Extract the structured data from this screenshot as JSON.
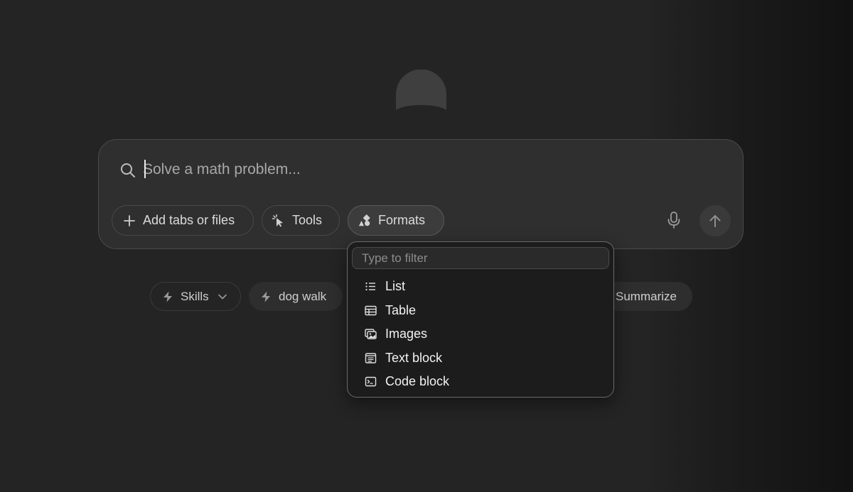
{
  "composer": {
    "placeholder": "Solve a math problem...",
    "chips": {
      "add": "Add tabs or files",
      "tools": "Tools",
      "formats": "Formats"
    }
  },
  "suggestions": {
    "skills": "Skills",
    "dog_walk": "dog walk",
    "summarize": "Summarize"
  },
  "formats_menu": {
    "filter_placeholder": "Type to filter",
    "items": [
      {
        "label": "List",
        "icon": "list-icon"
      },
      {
        "label": "Table",
        "icon": "table-icon"
      },
      {
        "label": "Images",
        "icon": "images-icon"
      },
      {
        "label": "Text block",
        "icon": "text-block-icon"
      },
      {
        "label": "Code block",
        "icon": "code-block-icon"
      }
    ]
  },
  "colors": {
    "background": "#242424",
    "composer": "#2f2f2f",
    "dropdown": "#1c1c1c",
    "text": "#e6e6e6"
  }
}
